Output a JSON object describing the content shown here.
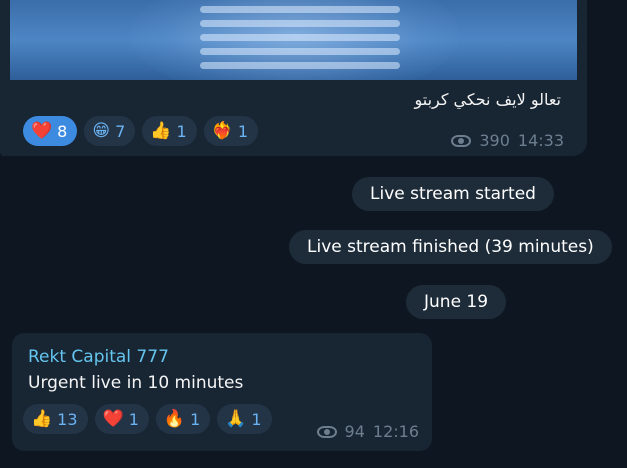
{
  "post_top": {
    "caption": "تعالو لايف نحكي كربتو",
    "reactions": [
      {
        "emoji": "❤️",
        "count": "8",
        "active": true
      },
      {
        "emoji": "😁",
        "count": "7",
        "active": false
      },
      {
        "emoji": "👍",
        "count": "1",
        "active": false
      },
      {
        "emoji": "❤️‍🔥",
        "count": "1",
        "active": false
      }
    ],
    "views": "390",
    "time": "14:33"
  },
  "service_messages": {
    "live_started": "Live stream started",
    "live_finished": "Live stream finished (39 minutes)",
    "date_divider": "June 19"
  },
  "post_bottom": {
    "author": "Rekt Capital 777",
    "text": "Urgent live in 10 minutes",
    "reactions": [
      {
        "emoji": "👍",
        "count": "13"
      },
      {
        "emoji": "❤️",
        "count": "1"
      },
      {
        "emoji": "🔥",
        "count": "1"
      },
      {
        "emoji": "🙏",
        "count": "1"
      }
    ],
    "views": "94",
    "time": "12:16"
  },
  "colors": {
    "background": "#0e1621",
    "bubble": "#182533",
    "author": "#64c5ee",
    "reaction_active": "#3c8be0",
    "meta": "#6d7f8f"
  }
}
